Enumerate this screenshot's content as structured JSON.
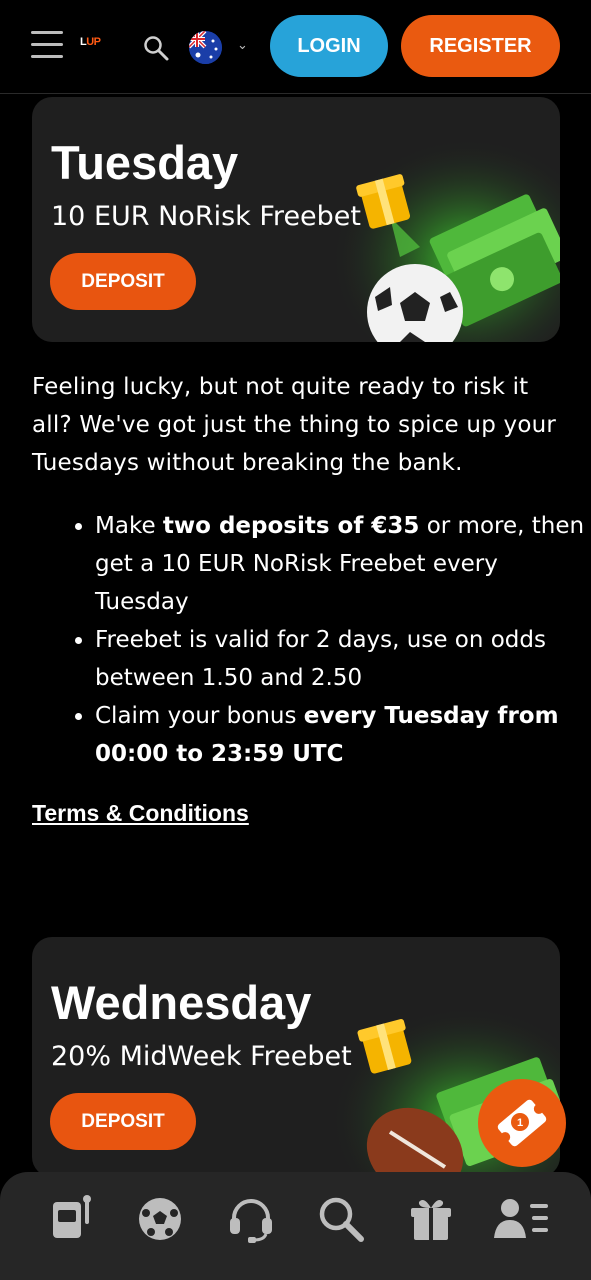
{
  "header": {
    "logo_text": "UP",
    "logo_mark": "L",
    "login_label": "LOGIN",
    "register_label": "REGISTER",
    "language_flag": "australia-flag-icon"
  },
  "promos": [
    {
      "day": "Tuesday",
      "offer": "10 EUR NoRisk Freebet",
      "button_label": "DEPOSIT"
    },
    {
      "day": "Wednesday",
      "offer": "20% MidWeek Freebet",
      "button_label": "DEPOSIT"
    }
  ],
  "content": {
    "intro": "Feeling lucky, but not quite ready to risk it all? We've got just the thing to spice up your Tuesdays without breaking the bank.",
    "bullet1_a": "Make ",
    "bullet1_b": "two deposits of €35",
    "bullet1_c": " or more, then get a 10 EUR NoRisk Freebet every Tuesday",
    "bullet2": "Freebet is valid for 2 days, use on odds between 1.50 and 2.50",
    "bullet3_a": "Claim your bonus ",
    "bullet3_b": "every Tuesday from 00:00 to 23:59 UTC",
    "terms_link": "Terms & Conditions"
  },
  "betslip": {
    "count": "1"
  },
  "bottom_nav": [
    "slots-icon",
    "sports-ball-icon",
    "support-headset-icon",
    "search-icon",
    "gift-icon",
    "profile-menu-icon"
  ],
  "colors": {
    "accent_orange": "#ea5a10",
    "login_blue": "#27a3d9",
    "card_bg": "#1f1f1f",
    "nav_bg": "#262626"
  }
}
